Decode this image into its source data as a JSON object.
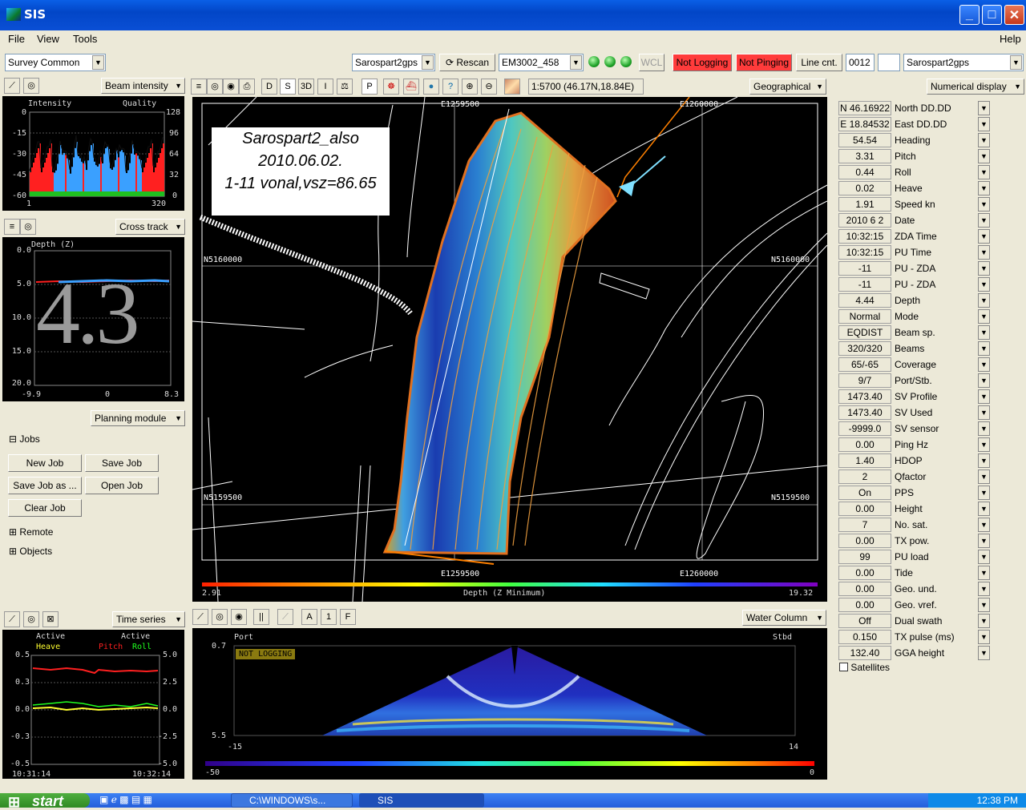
{
  "window": {
    "title": "SIS"
  },
  "menu": {
    "file": "File",
    "view": "View",
    "tools": "Tools",
    "help": "Help"
  },
  "toolbar": {
    "survey_combo": "Survey Common",
    "gps_combo": "Sarospart2gps",
    "rescan": "Rescan",
    "em_combo": "EM3002_458",
    "wcl": "WCL",
    "not_logging": "Not Logging",
    "not_pinging": "Not Pinging",
    "line_cnt": "Line cnt.",
    "line_num": "0012",
    "gps_combo2": "Sarospart2gps"
  },
  "beam_panel": {
    "dropdown": "Beam intensity",
    "left_title": "Intensity",
    "right_title": "Quality",
    "y_left": [
      "0",
      "-15",
      "-30",
      "-45",
      "-60"
    ],
    "y_right": [
      "128",
      "96",
      "64",
      "32",
      "0"
    ],
    "x_left": "1",
    "x_right": "320"
  },
  "cross_panel": {
    "dropdown": "Cross track",
    "title": "Depth (Z)",
    "big_value": "4.3",
    "y_ticks": [
      "0.0",
      "5.0",
      "10.0",
      "15.0",
      "20.0"
    ],
    "x_ticks": [
      "-9.9",
      "0",
      "8.3"
    ]
  },
  "planning": {
    "dropdown": "Planning module",
    "jobs_label": "Jobs",
    "new_job": "New Job",
    "save_job": "Save Job",
    "save_job_as": "Save Job as ...",
    "open_job": "Open Job",
    "clear_job": "Clear Job",
    "remote": "Remote",
    "objects": "Objects"
  },
  "time_panel": {
    "dropdown": "Time series",
    "active_left": "Active",
    "heave": "Heave",
    "active_right": "Active",
    "pitch": "Pitch",
    "roll": "Roll",
    "y_left": [
      "0.5",
      "0.3",
      "0.0",
      "-0.3",
      "-0.5"
    ],
    "y_right": [
      "5.0",
      "2.5",
      "0.0",
      "-2.5",
      "-5.0"
    ],
    "t_start": "10:31:14",
    "t_end": "10:32:14"
  },
  "map_toolbar": {
    "d": "D",
    "s": "S",
    "three_d": "3D",
    "i": "I",
    "p": "P",
    "scale": "1:5700 (46.17N,18.84E)",
    "projection": "Geographical"
  },
  "map": {
    "label_line1": "Sarospart2_also",
    "label_line2": "2010.06.02.",
    "label_line3": "1-11 vonal,vsz=86.65",
    "e_top_left": "E1259500",
    "e_top_right": "E1260000",
    "e_bot_left": "E1259500",
    "e_bot_right": "E1260000",
    "n_upper_left": "N5160000",
    "n_upper_right": "N5160000",
    "n_lower_left": "N5159500",
    "n_lower_right": "N5159500",
    "scale_min": "2.91",
    "scale_title": "Depth (Z Minimum)",
    "scale_max": "19.32"
  },
  "water_column": {
    "dropdown": "Water Column",
    "port": "Port",
    "stbd": "Stbd",
    "not_logging": "NOT LOGGING",
    "y_top": "0.7",
    "y_bottom": "5.5",
    "x_left": "-15",
    "x_right": "14",
    "scale_min": "-50",
    "scale_max": "0"
  },
  "numerical": {
    "dropdown": "Numerical display",
    "rows": [
      {
        "value": "N 46.16922",
        "label": "North DD.DD"
      },
      {
        "value": "E 18.84532",
        "label": "East DD.DD"
      },
      {
        "value": "54.54",
        "label": "Heading"
      },
      {
        "value": "3.31",
        "label": "Pitch"
      },
      {
        "value": "0.44",
        "label": "Roll"
      },
      {
        "value": "0.02",
        "label": "Heave"
      },
      {
        "value": "1.91",
        "label": "Speed kn"
      },
      {
        "value": "2010 6 2",
        "label": "Date"
      },
      {
        "value": "10:32:15",
        "label": "ZDA Time"
      },
      {
        "value": "10:32:15",
        "label": "PU Time"
      },
      {
        "value": "-11",
        "label": "PU - ZDA"
      },
      {
        "value": "-11",
        "label": "PU - ZDA"
      },
      {
        "value": "4.44",
        "label": "Depth"
      },
      {
        "value": "Normal",
        "label": "Mode"
      },
      {
        "value": "EQDIST",
        "label": "Beam sp."
      },
      {
        "value": "320/320",
        "label": "Beams"
      },
      {
        "value": "65/-65",
        "label": "Coverage"
      },
      {
        "value": "9/7",
        "label": "Port/Stb."
      },
      {
        "value": "1473.40",
        "label": "SV Profile"
      },
      {
        "value": "1473.40",
        "label": "SV Used"
      },
      {
        "value": "-9999.0",
        "label": "SV sensor"
      },
      {
        "value": "0.00",
        "label": "Ping Hz"
      },
      {
        "value": "1.40",
        "label": "HDOP"
      },
      {
        "value": "2",
        "label": "Qfactor"
      },
      {
        "value": "On",
        "label": "PPS"
      },
      {
        "value": "0.00",
        "label": "Height"
      },
      {
        "value": "7",
        "label": "No. sat."
      },
      {
        "value": "0.00",
        "label": "TX pow."
      },
      {
        "value": "99",
        "label": "PU load"
      },
      {
        "value": "0.00",
        "label": "Tide"
      },
      {
        "value": "0.00",
        "label": "Geo. und."
      },
      {
        "value": "0.00",
        "label": "Geo. vref."
      },
      {
        "value": "Off",
        "label": "Dual swath"
      },
      {
        "value": "0.150",
        "label": "TX pulse (ms)"
      },
      {
        "value": "132.40",
        "label": "GGA height"
      }
    ],
    "satellites": "Satellites"
  },
  "taskbar": {
    "start": "start",
    "task1": "C:\\WINDOWS\\s...",
    "task2": "SIS",
    "clock": "12:38 PM"
  },
  "colors": {
    "title_blue": "#0a4fd5",
    "alert_red": "#ff3b3b",
    "pitch_red": "#ff2020",
    "roll_green": "#20ff20",
    "heave_yellow": "#ffff30"
  }
}
